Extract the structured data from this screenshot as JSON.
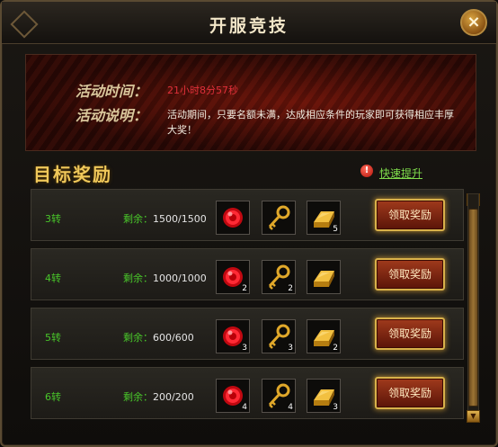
{
  "window": {
    "title": "开服竞技",
    "close_label": "×"
  },
  "banner": {
    "time_label": "活动时间：",
    "time_value": "21小时8分57秒",
    "desc_label": "活动说明：",
    "desc_value": "活动期间，只要名额未满，达成相应条件的玩家即可获得相应丰厚大奖！"
  },
  "section": {
    "title": "目标奖励",
    "quick_icon": "!",
    "quick_link": "快速提升"
  },
  "rows": [
    {
      "rank": "3转",
      "remain_label": "剩余：",
      "remain_value": "1500/1500",
      "items": [
        {
          "icon": "red-orb-icon",
          "count": ""
        },
        {
          "icon": "gold-key-icon",
          "count": ""
        },
        {
          "icon": "gold-bar-icon",
          "count": "5"
        }
      ],
      "button": "领取奖励"
    },
    {
      "rank": "4转",
      "remain_label": "剩余：",
      "remain_value": "1000/1000",
      "items": [
        {
          "icon": "red-orb-icon",
          "count": "2"
        },
        {
          "icon": "gold-key-icon",
          "count": "2"
        },
        {
          "icon": "gold-bar-icon",
          "count": ""
        }
      ],
      "button": "领取奖励"
    },
    {
      "rank": "5转",
      "remain_label": "剩余：",
      "remain_value": "600/600",
      "items": [
        {
          "icon": "red-orb-icon",
          "count": "3"
        },
        {
          "icon": "gold-key-icon",
          "count": "3"
        },
        {
          "icon": "gold-bar-icon",
          "count": "2"
        }
      ],
      "button": "领取奖励"
    },
    {
      "rank": "6转",
      "remain_label": "剩余：",
      "remain_value": "200/200",
      "items": [
        {
          "icon": "red-orb-icon",
          "count": "4"
        },
        {
          "icon": "gold-key-icon",
          "count": "4"
        },
        {
          "icon": "gold-bar-icon",
          "count": "3"
        }
      ],
      "button": "领取奖励"
    }
  ],
  "scrollbar": {
    "up": "▲",
    "down": "▼"
  },
  "colors": {
    "accent_gold": "#f0c85a",
    "green_text": "#49c72a",
    "red_time": "#e0303a",
    "link_green": "#7fdc4c"
  }
}
